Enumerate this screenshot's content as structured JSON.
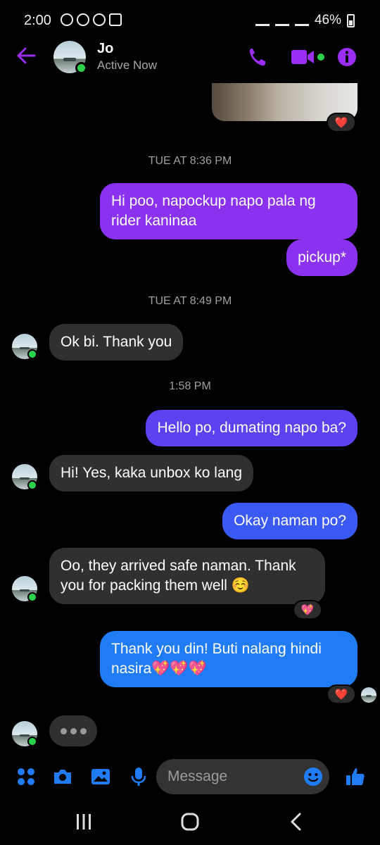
{
  "status_bar": {
    "time": "2:00",
    "battery": "46%"
  },
  "header": {
    "name": "Jo",
    "status": "Active Now"
  },
  "colors": {
    "accent": "#9b2ef5",
    "blue": "#1f7cf5",
    "mid": "#5a3ff0",
    "incoming": "#303030",
    "online": "#2bd34d"
  },
  "messages": [
    {
      "type": "timestamp",
      "text": "TUE AT 8:36 PM"
    },
    {
      "type": "outgoing",
      "text": "Hi poo, napockup napo pala ng rider kaninaa"
    },
    {
      "type": "outgoing",
      "text": "pickup*"
    },
    {
      "type": "timestamp",
      "text": "TUE AT 8:49 PM"
    },
    {
      "type": "incoming",
      "text": "Ok bi. Thank you"
    },
    {
      "type": "timestamp",
      "text": "1:58 PM"
    },
    {
      "type": "outgoing",
      "text": "Hello po, dumating napo ba?"
    },
    {
      "type": "incoming",
      "text": "Hi! Yes, kaka unbox ko lang"
    },
    {
      "type": "outgoing",
      "text": "Okay naman po?"
    },
    {
      "type": "incoming",
      "text": "Oo, they arrived safe naman. Thank you for packing them well ☺️"
    },
    {
      "type": "outgoing",
      "text": "Thank you din! Buti nalang hindi nasira💖💖💖"
    }
  ],
  "reactions": {
    "photo": "❤️",
    "incoming_last": "💖",
    "outgoing_last": "❤️"
  },
  "composer": {
    "placeholder": "Message"
  }
}
